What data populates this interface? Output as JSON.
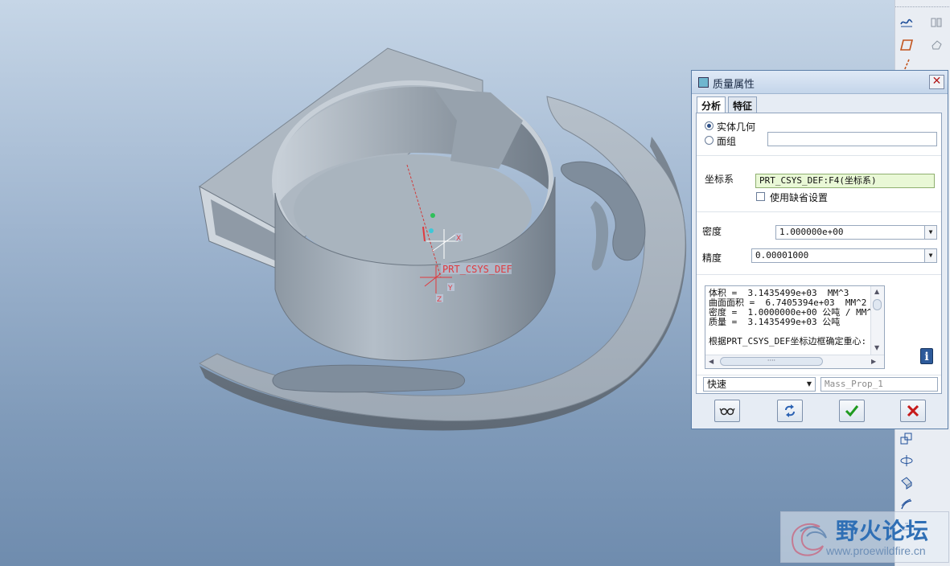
{
  "viewport": {
    "csys_label": "PRT_CSYS_DEF",
    "axis_labels": [
      "X",
      "Y",
      "Z"
    ]
  },
  "dialog": {
    "title": "质量属性",
    "tabs": [
      {
        "label": "分析",
        "active": true
      },
      {
        "label": "特征",
        "active": false
      }
    ],
    "geometry": {
      "solid_label": "实体几何",
      "quilt_label": "面组",
      "selected": "solid",
      "quilt_value": ""
    },
    "csys": {
      "label": "坐标系",
      "value": "PRT_CSYS_DEF:F4(坐标系)",
      "use_default_label": "使用缺省设置",
      "use_default_checked": false
    },
    "density": {
      "label": "密度",
      "value": "1.000000e+00"
    },
    "accuracy": {
      "label": "精度",
      "value": "0.00001000"
    },
    "results": [
      "体积 =  3.1435499e+03  MM^3",
      "曲面面积 =  6.7405394e+03  MM^2",
      "密度 =  1.0000000e+00 公吨 / MM^3",
      "质量 =  3.1435499e+03 公吨",
      "",
      "根据PRT_CSYS_DEF坐标边框确定重心:"
    ],
    "hscroll_thumb_text": "····",
    "mode": {
      "value": "快速"
    },
    "analysis_name": {
      "value": "Mass_Prop_1"
    },
    "info_glyph": "i",
    "close_glyph": "✕"
  },
  "watermark": {
    "title": "野火论坛",
    "url": "www.proewildfire.cn"
  },
  "colors": {
    "part_face": "#a7b2bd",
    "dialog_bg": "#e6ecf4",
    "ok_green": "#1f9a1f",
    "cancel_red": "#c61a1a",
    "csys_red": "#e0393e"
  }
}
